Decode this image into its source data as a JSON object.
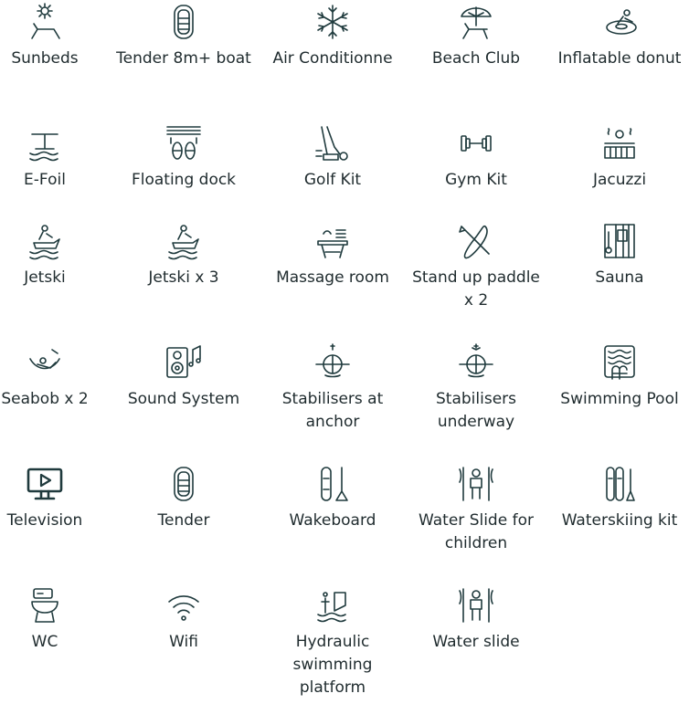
{
  "amenities": [
    {
      "label": "Sunbeds",
      "icon": "sunbed-icon"
    },
    {
      "label": "Tender 8m+ boat",
      "icon": "tender-boat-icon"
    },
    {
      "label": "Air Conditionne",
      "icon": "snowflake-icon"
    },
    {
      "label": "Beach Club",
      "icon": "beach-umbrella-icon"
    },
    {
      "label": "Inflatable donut",
      "icon": "inflatable-donut-icon"
    },
    {
      "label": "E-Foil",
      "icon": "efoil-icon"
    },
    {
      "label": "Floating dock",
      "icon": "floating-dock-icon"
    },
    {
      "label": "Golf Kit",
      "icon": "golf-kit-icon"
    },
    {
      "label": "Gym Kit",
      "icon": "dumbbell-icon"
    },
    {
      "label": "Jacuzzi",
      "icon": "jacuzzi-icon"
    },
    {
      "label": "Jetski",
      "icon": "jetski-icon"
    },
    {
      "label": "Jetski x 3",
      "icon": "jetski-icon"
    },
    {
      "label": "Massage room",
      "icon": "massage-table-icon"
    },
    {
      "label": "Stand up paddle x 2",
      "icon": "paddle-board-icon"
    },
    {
      "label": "Sauna",
      "icon": "sauna-icon"
    },
    {
      "label": "Seabob x 2",
      "icon": "seabob-icon"
    },
    {
      "label": "Sound System",
      "icon": "speaker-icon"
    },
    {
      "label": "Stabilisers at anchor",
      "icon": "stabiliser-anchor-icon"
    },
    {
      "label": "Stabilisers underway",
      "icon": "stabiliser-underway-icon"
    },
    {
      "label": "Swimming Pool",
      "icon": "swimming-pool-icon"
    },
    {
      "label": "Television",
      "icon": "television-icon"
    },
    {
      "label": "Tender",
      "icon": "tender-boat-icon"
    },
    {
      "label": "Wakeboard",
      "icon": "wakeboard-icon"
    },
    {
      "label": "Water Slide for children",
      "icon": "water-slide-icon"
    },
    {
      "label": "Waterskiing kit",
      "icon": "waterski-icon"
    },
    {
      "label": "WC",
      "icon": "toilet-icon"
    },
    {
      "label": "Wifi",
      "icon": "wifi-icon"
    },
    {
      "label": "Hydraulic swimming platform",
      "icon": "swim-platform-icon"
    },
    {
      "label": "Water slide",
      "icon": "water-slide-icon"
    }
  ],
  "colors": {
    "icon_stroke": "#1f3a3d",
    "text": "#1f2b2e",
    "background": "#ffffff"
  }
}
